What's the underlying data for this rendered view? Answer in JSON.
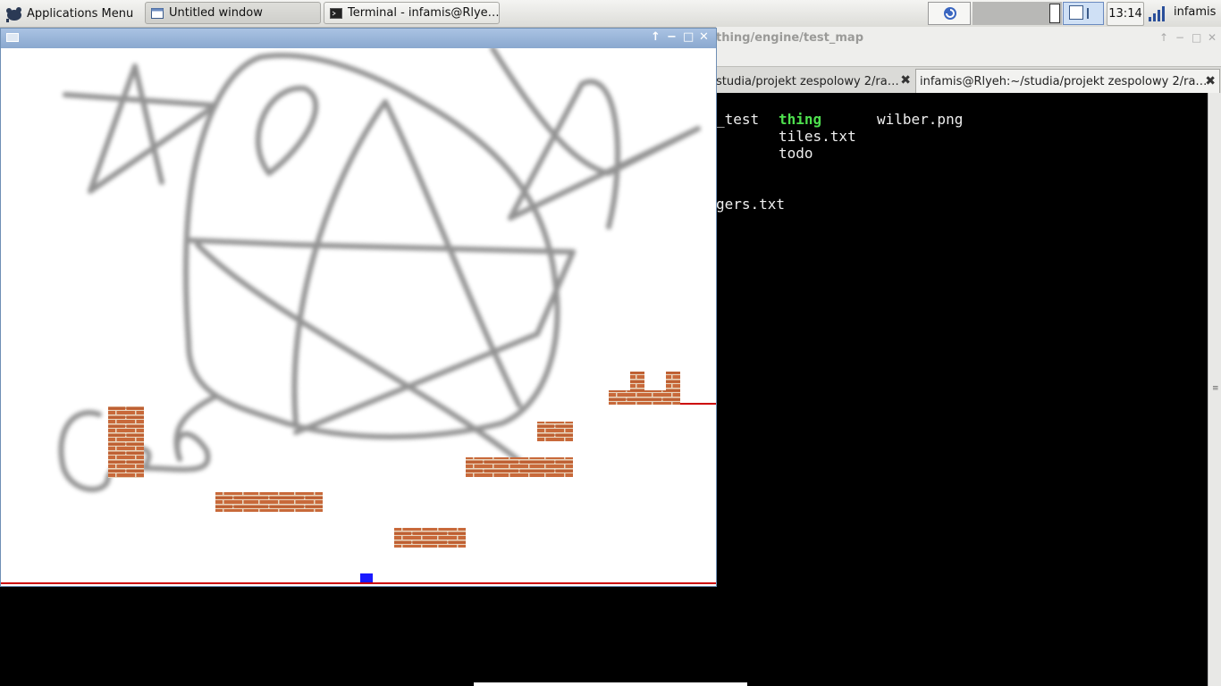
{
  "panel": {
    "app_menu_label": "Applications Menu",
    "tasks": [
      {
        "label": "Untitled window",
        "icon": "window-icon"
      },
      {
        "label": "Terminal - infamis@Rlye…",
        "icon": "terminal-icon"
      }
    ],
    "clock": "13:14",
    "user": "infamis"
  },
  "terminal": {
    "window_title": "thing/engine/test_map",
    "tabs": [
      {
        "label": "studia/projekt zespolowy 2/ra…"
      },
      {
        "label": "infamis@Rlyeh:~/studia/projekt zespolowy 2/ra…"
      }
    ],
    "lines": {
      "col1_row1": "_test",
      "col2_row1": "thing",
      "col3_row1": "wilber.png",
      "col2_row2": "tiles.txt",
      "col2_row3": "todo",
      "col1_row5": "gers.txt"
    },
    "colors": {
      "dir": "#4ee04e",
      "text": "#eeeeee"
    }
  },
  "game_window": {
    "title": "Untitled window"
  },
  "colors": {
    "accent": "#8aa8cf",
    "player": "#1a1aff",
    "ground_line": "#cc0000",
    "brick": "#c8693a"
  }
}
